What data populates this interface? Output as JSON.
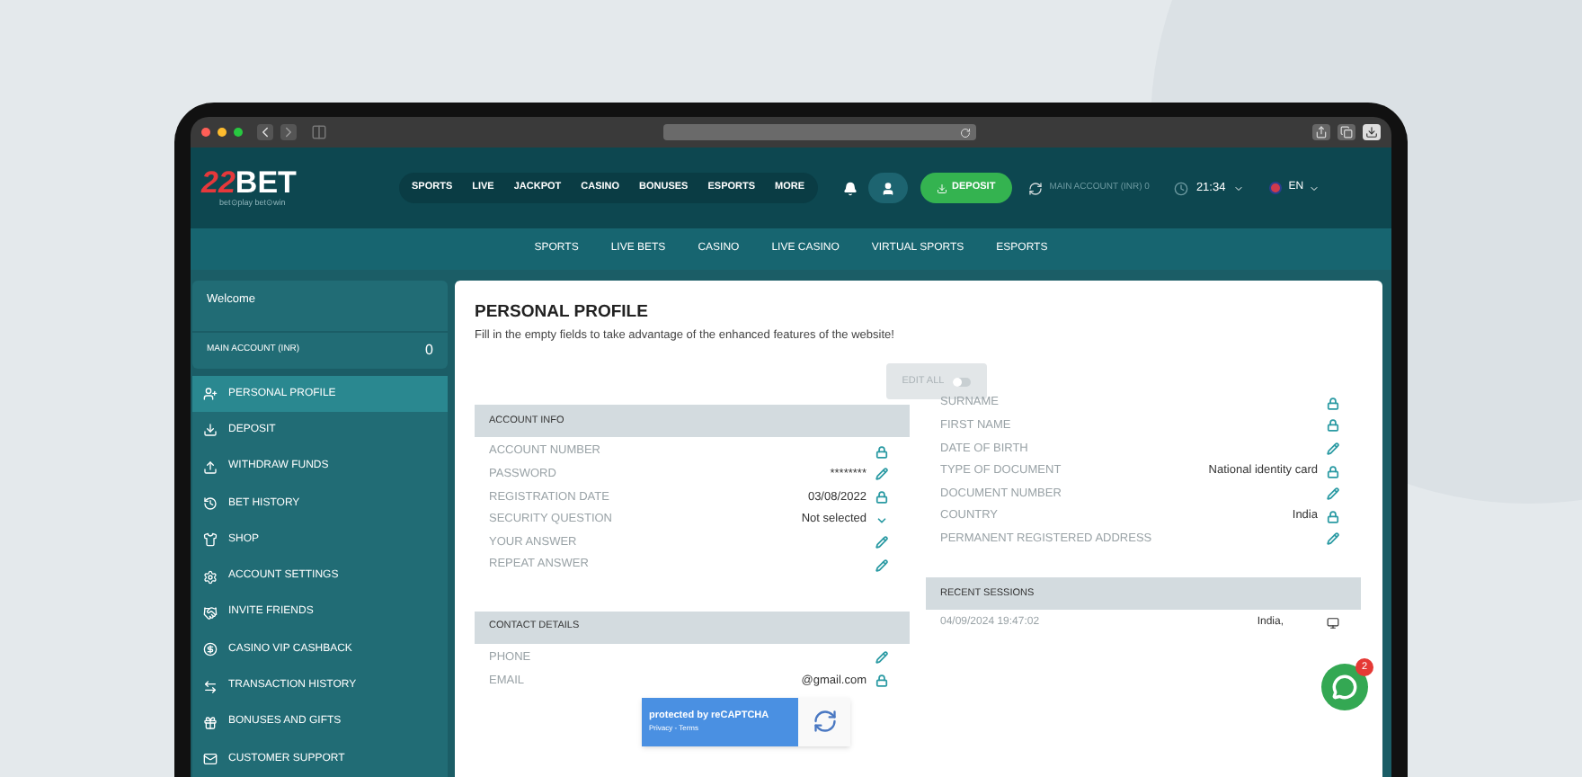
{
  "header": {
    "logo": {
      "mark": "22",
      "name": "BET",
      "tagline": "bet⊙play bet⊙win"
    },
    "nav": [
      "SPORTS",
      "LIVE",
      "JACKPOT",
      "CASINO",
      "BONUSES",
      "ESPORTS",
      "MORE"
    ],
    "deposit": "DEPOSIT",
    "account": "MAIN ACCOUNT (INR) 0",
    "time": "21:34",
    "language": "EN"
  },
  "subnav": [
    "SPORTS",
    "LIVE BETS",
    "CASINO",
    "LIVE CASINO",
    "VIRTUAL SPORTS",
    "ESPORTS"
  ],
  "sidebar": {
    "welcome": "Welcome",
    "account_label": "MAIN ACCOUNT (INR)",
    "balance": "0",
    "items": [
      {
        "label": "PERSONAL PROFILE",
        "selected": true
      },
      {
        "label": "DEPOSIT",
        "selected": false
      },
      {
        "label": "WITHDRAW FUNDS",
        "selected": false
      },
      {
        "label": "BET HISTORY",
        "selected": false
      },
      {
        "label": "SHOP",
        "selected": false
      },
      {
        "label": "ACCOUNT SETTINGS",
        "selected": false
      },
      {
        "label": "INVITE FRIENDS",
        "selected": false
      },
      {
        "label": "CASINO VIP CASHBACK",
        "selected": false
      },
      {
        "label": "TRANSACTION HISTORY",
        "selected": false
      },
      {
        "label": "BONUSES AND GIFTS",
        "selected": false
      },
      {
        "label": "CUSTOMER SUPPORT",
        "selected": false
      }
    ]
  },
  "profile": {
    "title": "PERSONAL PROFILE",
    "subtitle": "Fill in the empty fields to take advantage of the enhanced features of the website!",
    "edit_all": {
      "label": "EDIT ALL",
      "on": false
    },
    "account_info": {
      "title": "ACCOUNT INFO",
      "fields": [
        {
          "label": "ACCOUNT NUMBER",
          "kind": "locked"
        },
        {
          "label": "PASSWORD",
          "value": "********",
          "kind": "editable"
        },
        {
          "label": "REGISTRATION DATE",
          "value": "03/08/2022",
          "kind": "locked"
        },
        {
          "label": "SECURITY QUESTION",
          "value": "Not selected",
          "kind": "select"
        },
        {
          "label": "YOUR ANSWER",
          "kind": "editable"
        },
        {
          "label": "REPEAT ANSWER",
          "kind": "editable"
        }
      ]
    },
    "personal": {
      "fields": [
        {
          "label": "SURNAME",
          "kind": "locked"
        },
        {
          "label": "FIRST NAME",
          "kind": "locked"
        },
        {
          "label": "DATE OF BIRTH",
          "kind": "editable"
        },
        {
          "label": "TYPE OF DOCUMENT",
          "value": "National identity card",
          "kind": "locked"
        },
        {
          "label": "DOCUMENT NUMBER",
          "kind": "editable"
        },
        {
          "label": "COUNTRY",
          "value": "India",
          "kind": "locked"
        },
        {
          "label": "PERMANENT REGISTERED ADDRESS",
          "kind": "editable"
        }
      ]
    },
    "contact": {
      "title": "CONTACT DETAILS",
      "fields": [
        {
          "label": "PHONE",
          "kind": "editable"
        },
        {
          "label": "EMAIL",
          "value": "@gmail.com",
          "kind": "locked"
        }
      ]
    },
    "sessions": {
      "title": "RECENT SESSIONS",
      "rows": [
        {
          "time": "04/09/2024 19:47:02",
          "location": "India,"
        }
      ]
    },
    "recaptcha": {
      "text": "protected by reCAPTCHA",
      "links": "Privacy - Terms"
    },
    "chat": {
      "badge": "2"
    }
  }
}
